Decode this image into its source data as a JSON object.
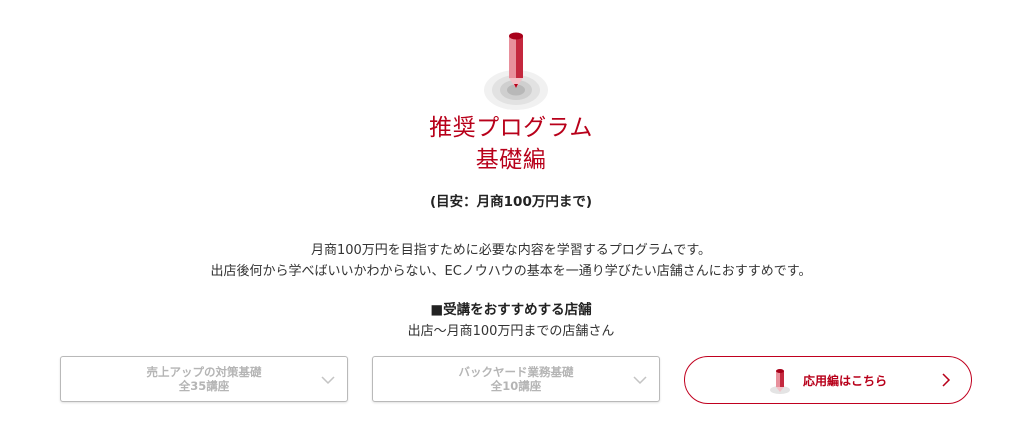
{
  "program": {
    "title_line1": "推奨プログラム",
    "title_line2": "基礎編",
    "target": "(目安：月商100万円まで)",
    "description_line1": "月商100万円を目指すために必要な内容を学習するプログラムです。",
    "description_line2": "出店後何から学べばいいかわからない、ECノウハウの基本を一通り学びたい店舗さんにおすすめです。",
    "recommend_heading": "■受講をおすすめする店舗",
    "recommend_text": "出店〜月商100万円までの店舗さん"
  },
  "cards": [
    {
      "title": "売上アップの対策基礎",
      "count": "全35講座"
    },
    {
      "title": "バックヤード業務基礎",
      "count": "全10講座"
    }
  ],
  "advanced_button": {
    "label": "応用編はこちら"
  },
  "colors": {
    "accent": "#b8001a",
    "disabled_text": "#b5b5b5",
    "border": "#b9b9b9"
  },
  "icons": {
    "hero": "pencil-icon",
    "dropdown": "chevron-down-icon",
    "link": "chevron-right-icon"
  }
}
